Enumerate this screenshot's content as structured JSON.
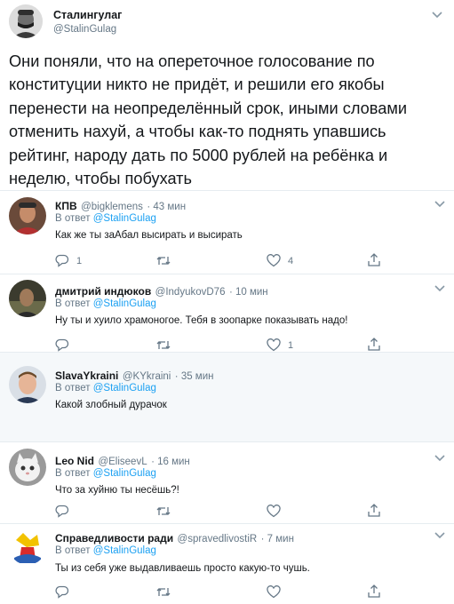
{
  "main_tweet": {
    "name": "Сталингулаг",
    "handle": "@StalinGulag",
    "text": "Они поняли, что на опереточное голосование по конституции никто не придёт, и решили его якобы перенести на неопределённый срок, иными словами отменить нахуй, а чтобы как-то поднять упавшись рейтинг, народу дать по 5000 рублей на ребёнка и неделю, чтобы побухать"
  },
  "reply_prefix": "В ответ",
  "replies": [
    {
      "name": "КПВ",
      "handle": "@bigklemens",
      "time": "· 43 мин",
      "mention": "@StalinGulag",
      "text": "Как же ты заАбал высирать и высирать",
      "reply_count": "1",
      "like_count": "4"
    },
    {
      "name": "дмитрий индюков",
      "handle": "@IndyukovD76",
      "time": "· 10 мин",
      "mention": "@StalinGulag",
      "text": "Ну ты и хуило храмоногое. Тебя в зоопарке показывать надо!",
      "like_count": "1"
    },
    {
      "name": "SlavaYkraini",
      "handle": "@KYkraini",
      "time": "· 35 мин",
      "mention": "@StalinGulag",
      "text": "Какой злобный дурачок"
    },
    {
      "name": "Leo Nid",
      "handle": "@EliseevL",
      "time": "· 16 мин",
      "mention": "@StalinGulag",
      "text": "Что за хуйню ты несёшь?!"
    },
    {
      "name": "Справедливости ради",
      "handle": "@spravedlivostiR",
      "time": "· 7 мин",
      "mention": "@StalinGulag",
      "text": "Ты из себя уже выдавливаешь просто какую-то чушь."
    }
  ],
  "icons": [
    "chevron-down-icon",
    "reply-icon",
    "retweet-icon",
    "like-icon",
    "share-icon"
  ],
  "colors": {
    "link": "#1da1f2",
    "secondary": "#657786",
    "divider": "#e6ecf0"
  }
}
